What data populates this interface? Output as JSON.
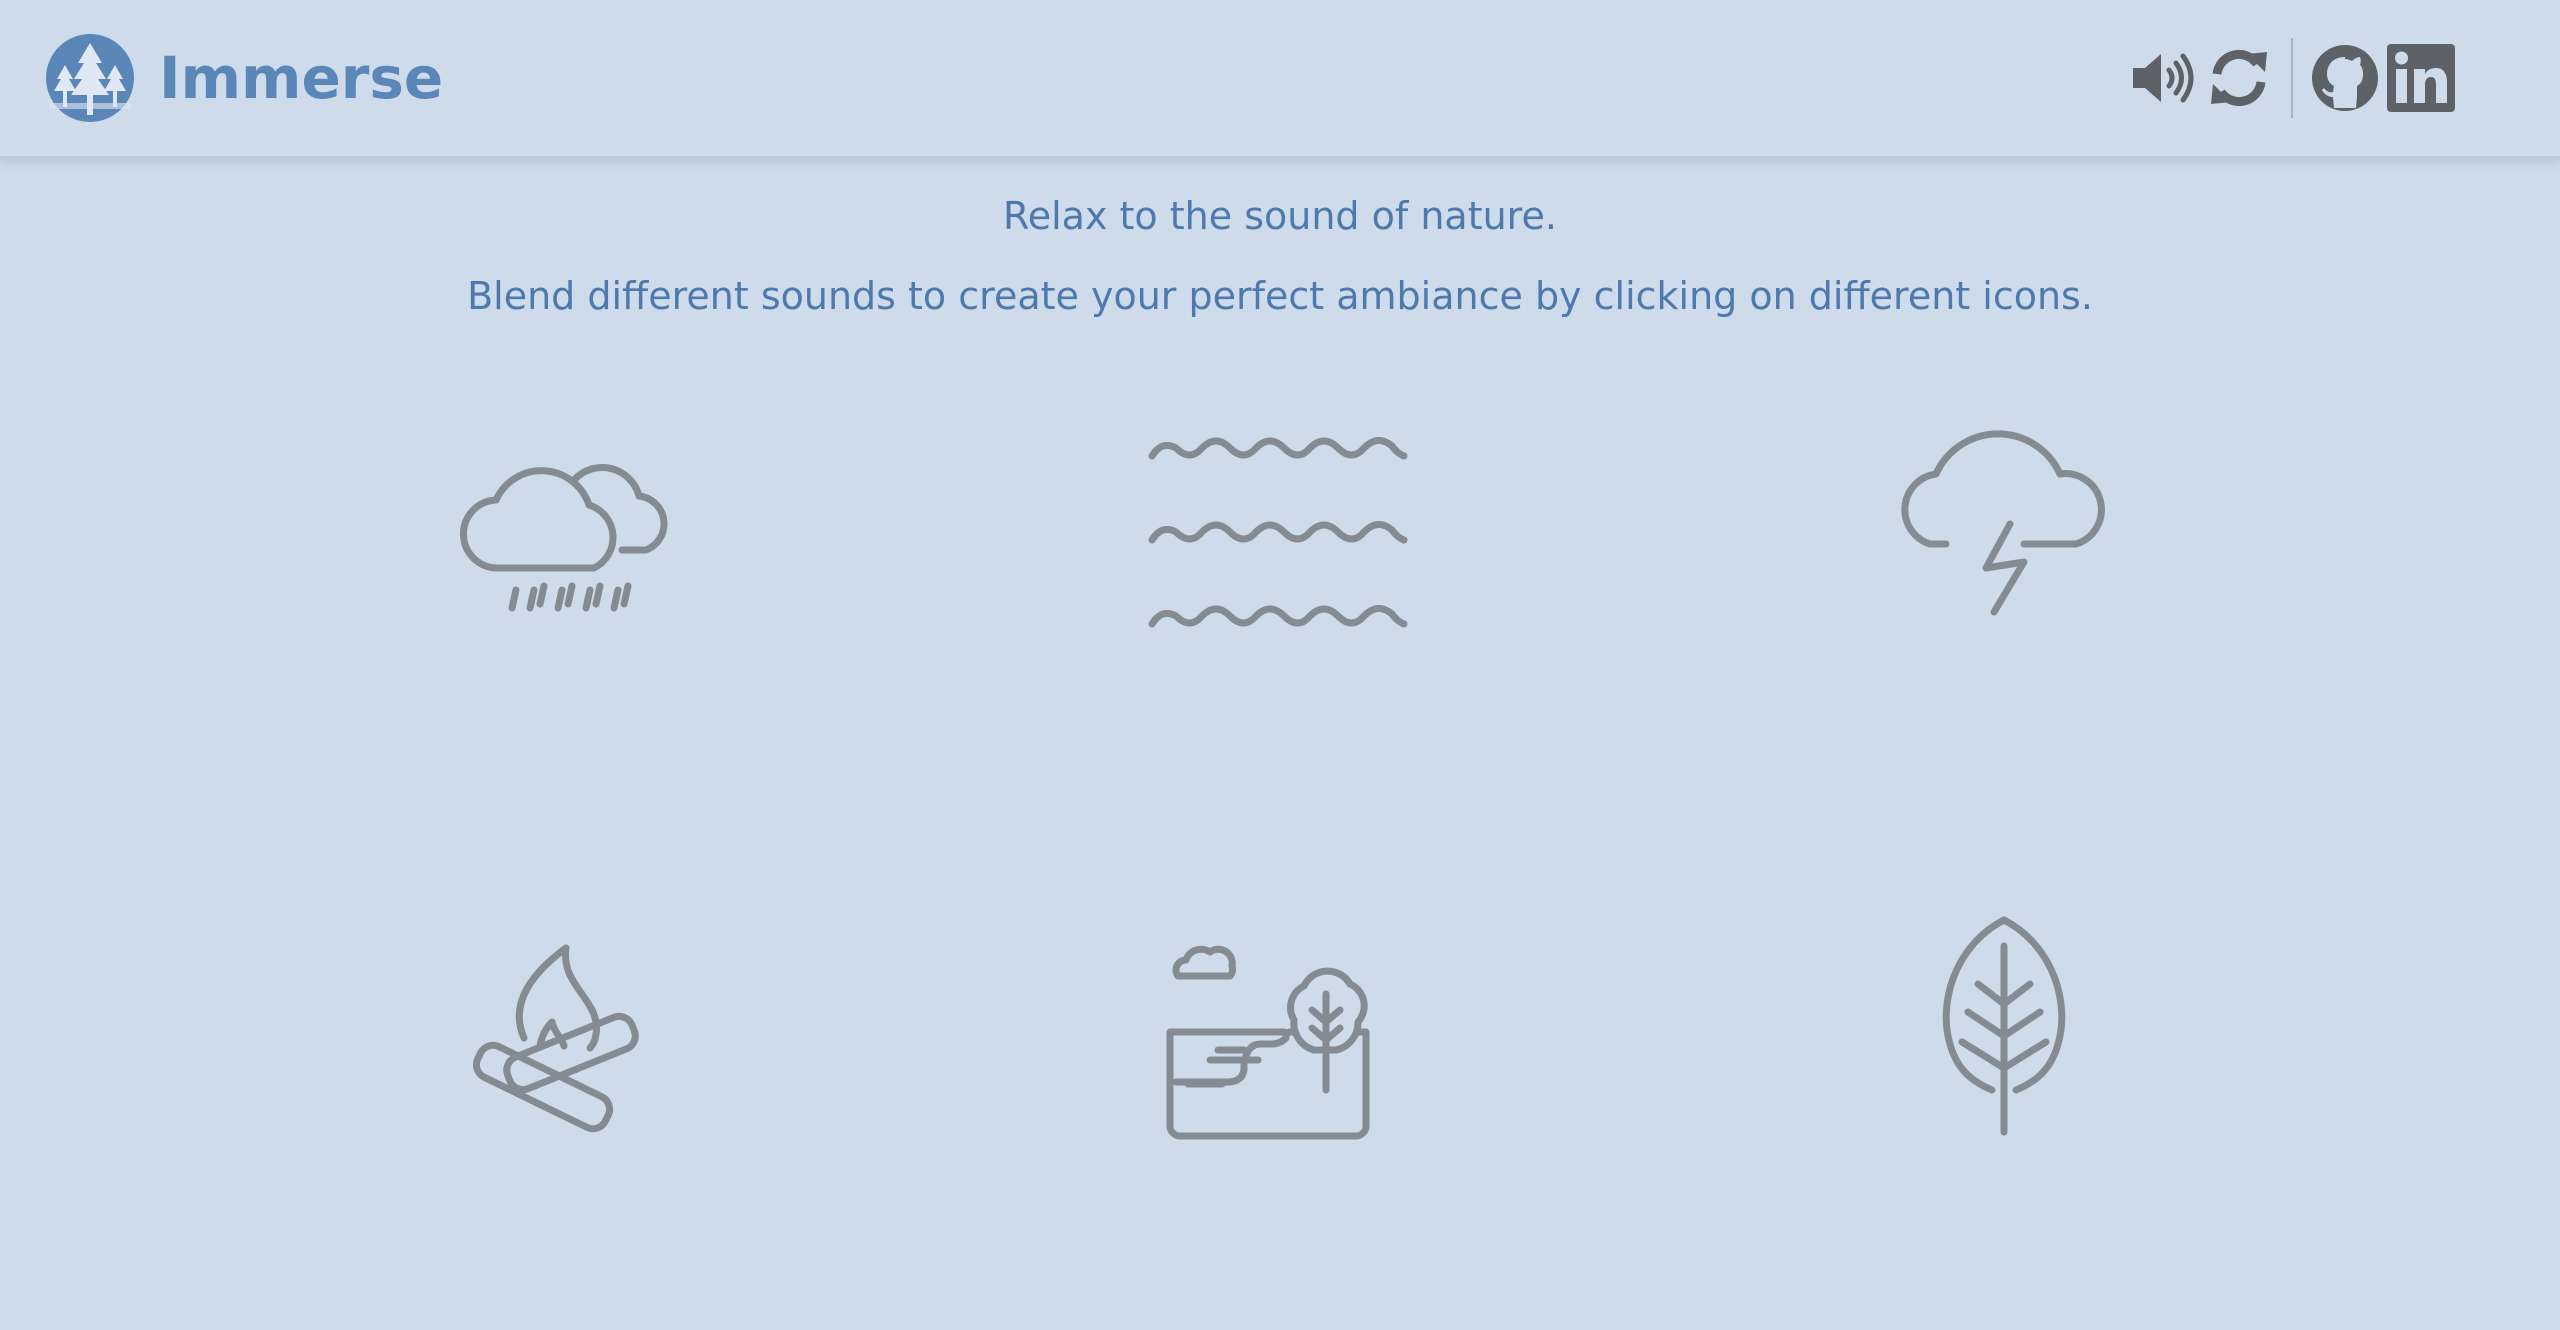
{
  "app": {
    "name": "Immerse"
  },
  "toolbar": {
    "items": [
      {
        "name": "volume",
        "icon": "volume-icon"
      },
      {
        "name": "refresh",
        "icon": "refresh-icon"
      },
      {
        "name": "github",
        "icon": "github-icon"
      },
      {
        "name": "linkedin",
        "icon": "linkedin-icon"
      }
    ]
  },
  "intro": {
    "line1": "Relax to the sound of nature.",
    "line2": "Blend different sounds to create your perfect ambiance by clicking on different icons."
  },
  "sounds": [
    {
      "id": "rain",
      "icon": "rain-cloud-icon"
    },
    {
      "id": "waves",
      "icon": "waves-icon"
    },
    {
      "id": "thunderstorm",
      "icon": "thunder-cloud-icon"
    },
    {
      "id": "campfire",
      "icon": "campfire-icon"
    },
    {
      "id": "lake",
      "icon": "lake-landscape-icon"
    },
    {
      "id": "leaves",
      "icon": "leaf-icon"
    }
  ],
  "colors": {
    "background": "#cedbea",
    "accent": "#5b86b8",
    "text": "#4e79ae",
    "icon": "#858b92",
    "toolbar_icon": "#5e6266"
  }
}
